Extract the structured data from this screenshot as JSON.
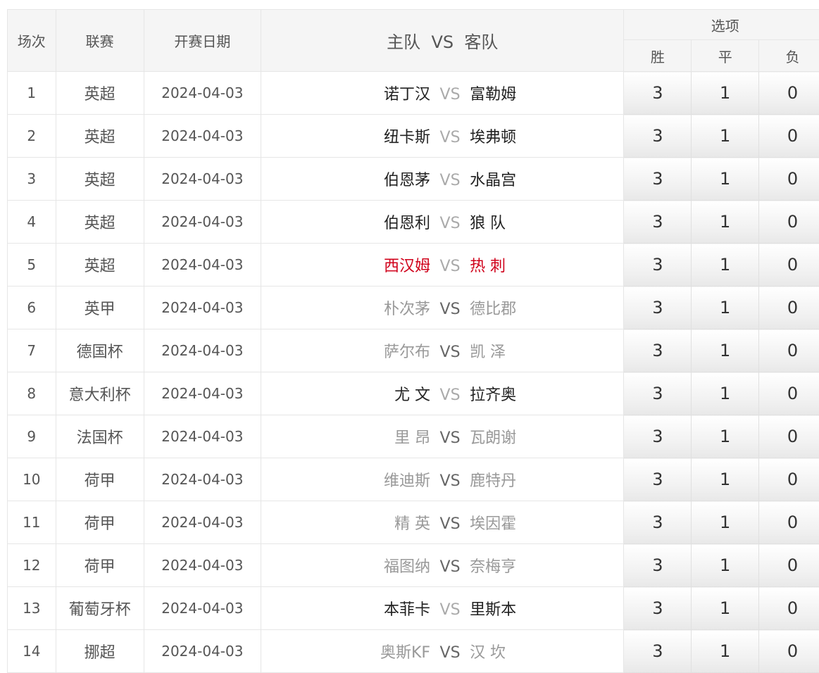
{
  "header": {
    "col_index": "场次",
    "col_league": "联赛",
    "col_date": "开赛日期",
    "col_match_home": "主队",
    "col_match_vs": "VS",
    "col_match_away": "客队",
    "col_options": "选项",
    "opt_win": "胜",
    "opt_draw": "平",
    "opt_lose": "负"
  },
  "colors": {
    "normal": "#222222",
    "gray": "#999999",
    "red": "#d0021b",
    "border": "#e6e6e6",
    "header_bg": "#f5f5f5"
  },
  "rows": [
    {
      "idx": "1",
      "league": "英超",
      "date": "2024-04-03",
      "home": "诺丁汉",
      "vs": "VS",
      "away": "富勒姆",
      "style": "normal",
      "win": "3",
      "draw": "1",
      "lose": "0"
    },
    {
      "idx": "2",
      "league": "英超",
      "date": "2024-04-03",
      "home": "纽卡斯",
      "vs": "VS",
      "away": "埃弗顿",
      "style": "normal",
      "win": "3",
      "draw": "1",
      "lose": "0"
    },
    {
      "idx": "3",
      "league": "英超",
      "date": "2024-04-03",
      "home": "伯恩茅",
      "vs": "VS",
      "away": "水晶宫",
      "style": "normal",
      "win": "3",
      "draw": "1",
      "lose": "0"
    },
    {
      "idx": "4",
      "league": "英超",
      "date": "2024-04-03",
      "home": "伯恩利",
      "vs": "VS",
      "away": "狼 队",
      "style": "normal",
      "win": "3",
      "draw": "1",
      "lose": "0"
    },
    {
      "idx": "5",
      "league": "英超",
      "date": "2024-04-03",
      "home": "西汉姆",
      "vs": "VS",
      "away": "热 刺",
      "style": "red",
      "win": "3",
      "draw": "1",
      "lose": "0"
    },
    {
      "idx": "6",
      "league": "英甲",
      "date": "2024-04-03",
      "home": "朴次茅",
      "vs": "VS",
      "away": "德比郡",
      "style": "gray",
      "win": "3",
      "draw": "1",
      "lose": "0"
    },
    {
      "idx": "7",
      "league": "德国杯",
      "date": "2024-04-03",
      "home": "萨尔布",
      "vs": "VS",
      "away": "凯 泽",
      "style": "gray",
      "win": "3",
      "draw": "1",
      "lose": "0"
    },
    {
      "idx": "8",
      "league": "意大利杯",
      "date": "2024-04-03",
      "home": "尤 文",
      "vs": "VS",
      "away": "拉齐奥",
      "style": "normal",
      "win": "3",
      "draw": "1",
      "lose": "0"
    },
    {
      "idx": "9",
      "league": "法国杯",
      "date": "2024-04-03",
      "home": "里 昂",
      "vs": "VS",
      "away": "瓦朗谢",
      "style": "gray",
      "win": "3",
      "draw": "1",
      "lose": "0"
    },
    {
      "idx": "10",
      "league": "荷甲",
      "date": "2024-04-03",
      "home": "维迪斯",
      "vs": "VS",
      "away": "鹿特丹",
      "style": "gray",
      "win": "3",
      "draw": "1",
      "lose": "0"
    },
    {
      "idx": "11",
      "league": "荷甲",
      "date": "2024-04-03",
      "home": "精 英",
      "vs": "VS",
      "away": "埃因霍",
      "style": "gray",
      "win": "3",
      "draw": "1",
      "lose": "0"
    },
    {
      "idx": "12",
      "league": "荷甲",
      "date": "2024-04-03",
      "home": "福图纳",
      "vs": "VS",
      "away": "奈梅亨",
      "style": "gray",
      "win": "3",
      "draw": "1",
      "lose": "0"
    },
    {
      "idx": "13",
      "league": "葡萄牙杯",
      "date": "2024-04-03",
      "home": "本菲卡",
      "vs": "VS",
      "away": "里斯本",
      "style": "normal",
      "win": "3",
      "draw": "1",
      "lose": "0"
    },
    {
      "idx": "14",
      "league": "挪超",
      "date": "2024-04-03",
      "home": "奥斯KF",
      "vs": "VS",
      "away": "汉 坎",
      "style": "gray",
      "win": "3",
      "draw": "1",
      "lose": "0"
    }
  ]
}
